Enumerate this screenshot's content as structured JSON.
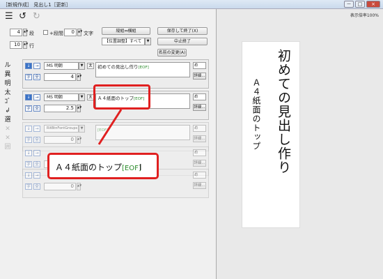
{
  "window": {
    "title": "［新規作成］ 見出し1［更新］",
    "controls": [
      "－",
      "□",
      "×"
    ]
  },
  "toolbar": {
    "icons": [
      "menu-icon",
      "undo-icon",
      "redo-icon"
    ]
  },
  "settings": {
    "columns_value": "4",
    "columns_label": "段",
    "interval_checkbox_label": "+段間",
    "interval_value": "0",
    "chars_label": "文字",
    "rows_value": "10",
    "rows_label": "行"
  },
  "buttons": {
    "orientation": "縦組⇔横組",
    "save_exit": "保存して終了(X)",
    "position_adjust": "【位置調整】すべて",
    "cancel_exit": "中止終了",
    "rename": "名前の変更(A)"
  },
  "vertical_toolbar": [
    "ル",
    "異",
    "明",
    "太",
    "ｺﾞ",
    "↲",
    "選",
    "✕",
    "✕",
    "囲"
  ],
  "rows": [
    {
      "font": "MS 明朝",
      "size": "4",
      "text": "初めての見出し作り",
      "eof": "[EOF]",
      "align": "め",
      "detail": "詳細...",
      "enabled": true
    },
    {
      "font": "MS 明朝",
      "size": "2.5",
      "text": "Ａ４紙面のトップ",
      "eof": "[EOF]",
      "align": "め",
      "detail": "詳細...",
      "enabled": true
    },
    {
      "font": "RitBtnFontGroups",
      "size": "0",
      "text": "",
      "eof": "[EOF]",
      "align": "め",
      "detail": "詳細...",
      "enabled": false
    },
    {
      "font": "",
      "size": "0",
      "text": "",
      "eof": "",
      "align": "め",
      "detail": "詳細...",
      "enabled": false
    },
    {
      "font": "",
      "size": "0",
      "text": "",
      "eof": "",
      "align": "め",
      "detail": "詳細...",
      "enabled": false
    }
  ],
  "callout": {
    "text": "Ａ４紙面のトップ",
    "eof": "[EOF]"
  },
  "preview": {
    "zoom_label": "表示倍率100%",
    "headline": "初めての見出し作り",
    "subline": "Ａ４紙面のトップ"
  }
}
